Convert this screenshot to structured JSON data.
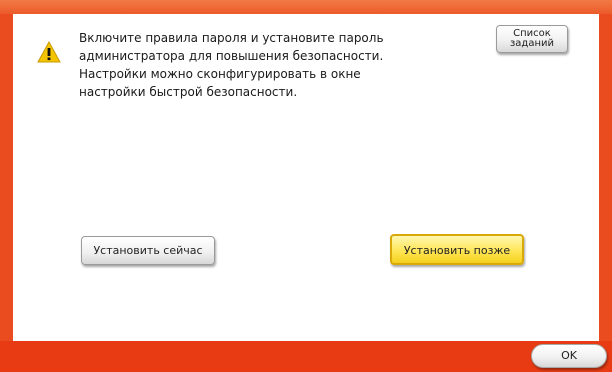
{
  "dialog": {
    "message_lines": [
      "Включите правила пароля и установите пароль",
      "администратора для повышения безопасности.",
      "Настройки можно сконфигурировать в окне",
      "настройки быстрой безопасности."
    ],
    "icon": "warning-icon"
  },
  "buttons": {
    "job_list_line1": "Список",
    "job_list_line2": "заданий",
    "set_now": "Установить сейчас",
    "set_later": "Установить позже",
    "ok": "OK"
  },
  "colors": {
    "frame": "#ea4b1f",
    "bottom_bar": "#e83b14",
    "selected_button": "#ffe657",
    "warning_icon": "#f5c400"
  }
}
